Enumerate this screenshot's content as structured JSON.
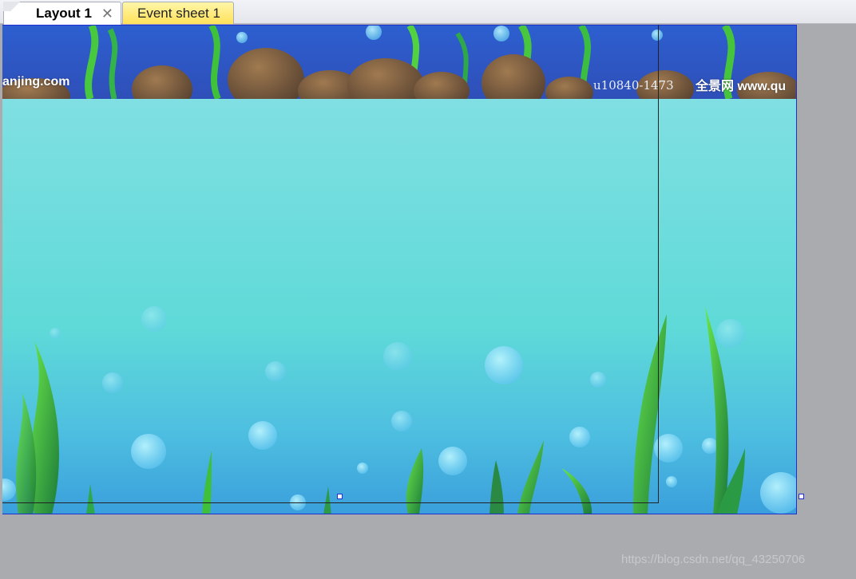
{
  "tabs": [
    {
      "label": "Layout 1",
      "active": true,
      "close_icon": "close-icon"
    },
    {
      "label": "Event sheet 1",
      "active": false
    }
  ],
  "layout": {
    "watermark_left": "anjing.com",
    "watermark_right": "全景网  www.qu",
    "image_code": "u10840-1473",
    "credit": "https://blog.csdn.net/qq_43250706"
  },
  "colors": {
    "selection_border": "#1f2fd0",
    "workspace": "#a9abaf",
    "water_top": "#7fe0e0",
    "water_bottom": "#3ea8e0"
  }
}
